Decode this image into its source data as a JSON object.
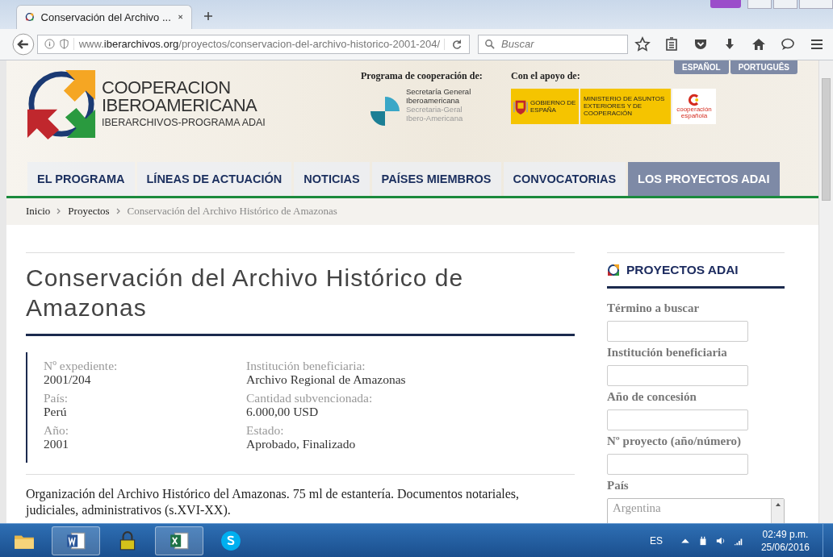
{
  "browser": {
    "tab_title": "Conservación del Archivo ...",
    "url": {
      "prefix": "www.",
      "domain": "iberarchivos.org",
      "path": "/proyectos/conservacion-del-archivo-historico-2001-204/"
    },
    "search": {
      "placeholder": "Buscar"
    }
  },
  "languages": [
    {
      "label": "ESPAÑOL",
      "selected": false
    },
    {
      "label": "PORTUGUÊS",
      "selected": false
    }
  ],
  "logo": {
    "lines": [
      "COOPERACION",
      "IBEROAMERICANA"
    ],
    "subline": "IBERARCHIVOS-PROGRAMA ADAI"
  },
  "program": {
    "label": "Programa de cooperación de:",
    "lines": [
      "Secretaría General",
      "Iberoamericana"
    ],
    "lines_pt": [
      "Secretaria-Geral",
      "Ibero-Americana"
    ]
  },
  "support": {
    "label": "Con el apoyo de:",
    "gobierno": "GOBIERNO DE ESPAÑA",
    "ministerio": "MINISTERIO DE ASUNTOS EXTERIORES Y DE COOPERACIÓN",
    "cooperacion": "cooperación española"
  },
  "nav": [
    {
      "label": "EL PROGRAMA",
      "selected": false
    },
    {
      "label": "LÍNEAS DE ACTUACIÓN",
      "selected": false
    },
    {
      "label": "NOTICIAS",
      "selected": false
    },
    {
      "label": "PAÍSES MIEMBROS",
      "selected": false
    },
    {
      "label": "CONVOCATORIAS",
      "selected": false
    },
    {
      "label": "LOS PROYECTOS ADAI",
      "selected": true
    }
  ],
  "breadcrumb": [
    {
      "label": "Inicio",
      "current": false
    },
    {
      "label": "Proyectos",
      "current": false
    },
    {
      "label": "Conservación del Archivo Histórico de Amazonas",
      "current": true
    }
  ],
  "title": "Conservación del Archivo Histórico de Amazonas",
  "details": [
    [
      {
        "label": "Nº expediente:",
        "value": "2001/204"
      },
      {
        "label": "País:",
        "value": "Perú"
      },
      {
        "label": "Año:",
        "value": "2001"
      }
    ],
    [
      {
        "label": "Institución beneficiaria:",
        "value": "Archivo Regional de Amazonas"
      },
      {
        "label": "Cantidad subvencionada:",
        "value": "6.000,00 USD"
      },
      {
        "label": "Estado:",
        "value": "Aprobado, Finalizado"
      }
    ]
  ],
  "description": "Organización del Archivo Histórico del Amazonas. 75 ml de estantería. Documentos notariales, judiciales, administrativos (s.XVI-XX).",
  "sidebar": {
    "heading": "PROYECTOS ADAI",
    "fields": [
      {
        "label": "Término a buscar",
        "kind": "text"
      },
      {
        "label": "Institución beneficiaria",
        "kind": "text"
      },
      {
        "label": "Año de concesión",
        "kind": "text"
      },
      {
        "label": "Nº proyecto (año/número)",
        "kind": "text"
      },
      {
        "label": "País",
        "kind": "list",
        "value": "Argentina"
      }
    ]
  },
  "taskbar": {
    "apps": [
      {
        "kind": "folder",
        "running": false
      },
      {
        "kind": "word",
        "running": true
      },
      {
        "kind": "lock",
        "running": false
      },
      {
        "kind": "excel",
        "running": true
      },
      {
        "kind": "skype",
        "running": false
      }
    ],
    "language": "ES",
    "time": "02:49 p.m.",
    "date": "25/06/2016"
  }
}
